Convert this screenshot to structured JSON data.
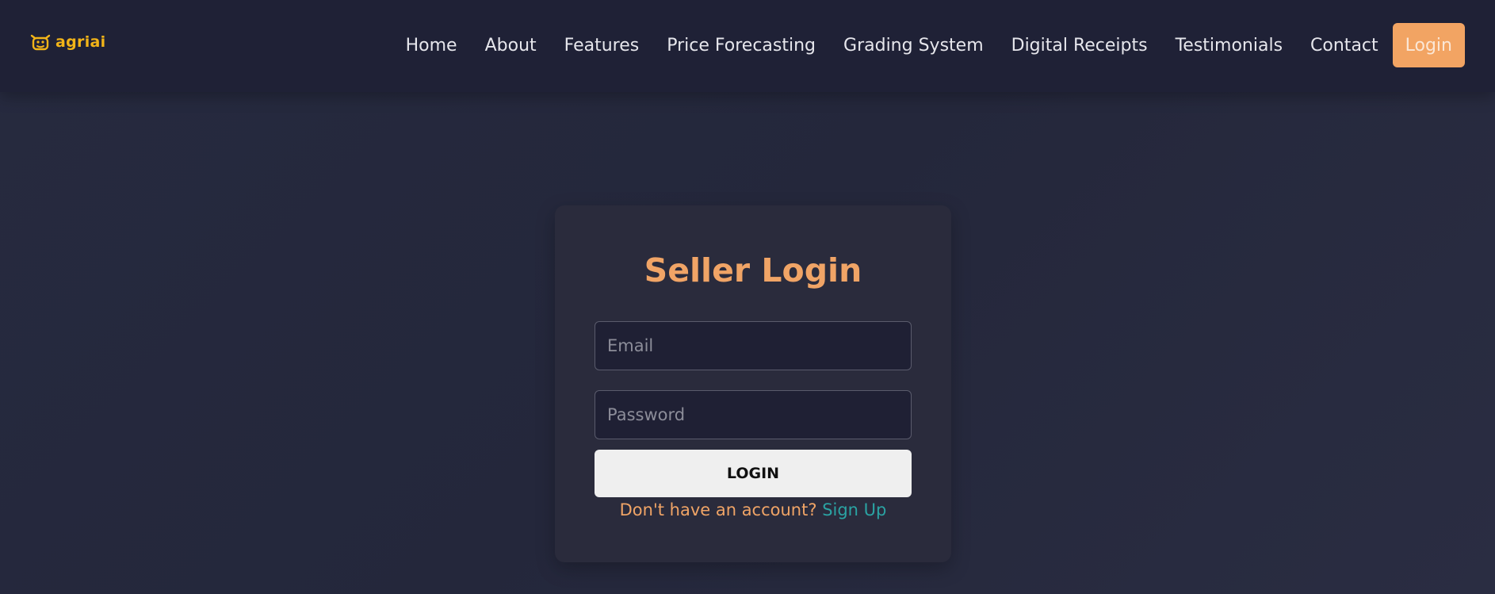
{
  "brand": {
    "name": "agriai",
    "icon": "bull-head-icon",
    "color": "#f2b418"
  },
  "nav": {
    "links": [
      "Home",
      "About",
      "Features",
      "Price Forecasting",
      "Grading System",
      "Digital Receipts",
      "Testimonials",
      "Contact"
    ],
    "login_label": "Login",
    "login_color": "#f2a463"
  },
  "login_card": {
    "title": "Seller Login",
    "email_placeholder": "Email",
    "email_value": "",
    "password_placeholder": "Password",
    "password_value": "",
    "submit_label": "LOGIN",
    "signup_prompt": "Don't have an account?",
    "signup_link": "Sign Up",
    "accent_color": "#f0a466",
    "link_color": "#2aa3a3"
  }
}
